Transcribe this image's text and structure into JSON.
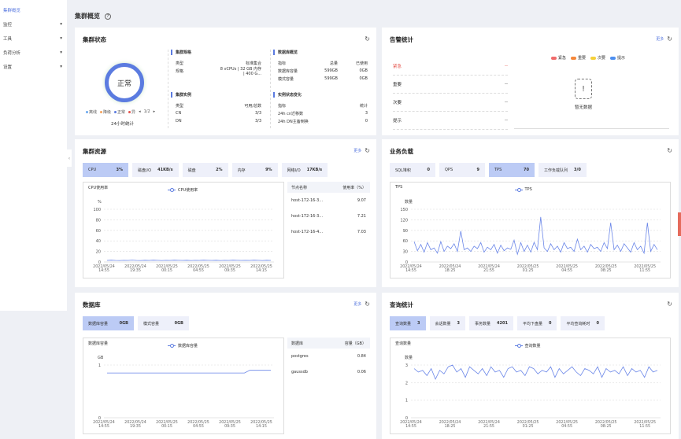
{
  "sidebar": {
    "items": [
      {
        "label": "集群概览",
        "active": true
      },
      {
        "label": "监控",
        "arrow": "▾"
      },
      {
        "label": "工具",
        "arrow": "▾"
      },
      {
        "label": "负荷分析",
        "arrow": "▾"
      },
      {
        "label": "设置",
        "arrow": "▾"
      }
    ],
    "collapse_icon": "‹"
  },
  "header": {
    "title": "集群概览",
    "help_icon": "?"
  },
  "status": {
    "title": "集群状态",
    "state": "正常",
    "legend": [
      {
        "label": "离线",
        "color": "#6aa8f0"
      },
      {
        "label": "降级",
        "color": "#f5a25d"
      },
      {
        "label": "正常",
        "color": "#5b7be0"
      },
      {
        "label": "异",
        "color": "#e5534b"
      }
    ],
    "page": "1/2",
    "stat_label": "24小时统计",
    "spec": {
      "title": "集群规格",
      "rows": [
        [
          "类型",
          "标准集合"
        ],
        [
          "规格",
          "8 vCPUs | 32 GB 内存 | 400 G..."
        ]
      ]
    },
    "instances": {
      "title": "集群实例",
      "rows": [
        [
          "类型",
          "可用/总数"
        ],
        [
          "CN",
          "3/3"
        ],
        [
          "DN",
          "3/3"
        ]
      ]
    },
    "db": {
      "title": "数据库概览",
      "rows": [
        [
          "指标",
          "总量",
          "已使用"
        ],
        [
          "数据库容量",
          "599GB",
          "0GB"
        ],
        [
          "模式容量",
          "599GB",
          "0GB"
        ]
      ]
    },
    "changes": {
      "title": "实例状态变化",
      "rows": [
        [
          "指标",
          "统计"
        ],
        [
          "24h cn迁移数",
          "3"
        ],
        [
          "24h DN主备倒换",
          "0"
        ]
      ]
    }
  },
  "alarm": {
    "title": "告警统计",
    "more": "更多",
    "rows": [
      {
        "label": "紧急",
        "value": "--",
        "color": "#e5534b"
      },
      {
        "label": "重要",
        "value": "--"
      },
      {
        "label": "次要",
        "value": "--"
      },
      {
        "label": "提示",
        "value": "--"
      }
    ],
    "legend": [
      {
        "label": "紧急",
        "color": "#f06b6b"
      },
      {
        "label": "重要",
        "color": "#f5883a"
      },
      {
        "label": "次要",
        "color": "#f5d03a"
      },
      {
        "label": "提示",
        "color": "#4d8ff0"
      }
    ],
    "empty": "暂无数据"
  },
  "resources": {
    "title": "集群资源",
    "more": "更多",
    "kpis": [
      {
        "label": "CPU",
        "value": "3%",
        "selected": true
      },
      {
        "label": "磁盘I/O",
        "value": "41KB/s"
      },
      {
        "label": "磁盘",
        "value": "2%"
      },
      {
        "label": "内存",
        "value": "9%"
      },
      {
        "label": "网络I/O",
        "value": "17KB/s"
      }
    ],
    "table": {
      "headers": [
        "节点名称",
        "使用率（%）"
      ],
      "rows": [
        [
          "host-172-16-3...",
          "9.07"
        ],
        [
          "host-172-16-3...",
          "7.21"
        ],
        [
          "host-172-16-4...",
          "7.03"
        ]
      ]
    }
  },
  "workload": {
    "title": "业务负载",
    "kpis": [
      {
        "label": "SQL堆积",
        "value": "0"
      },
      {
        "label": "QPS",
        "value": "9"
      },
      {
        "label": "TPS",
        "value": "70",
        "selected": true
      },
      {
        "label": "工作负载队列",
        "value": "3/0"
      }
    ]
  },
  "database": {
    "title": "数据库",
    "more": "更多",
    "kpis": [
      {
        "label": "数据库容量",
        "value": "0GB",
        "selected": true
      },
      {
        "label": "模式容量",
        "value": "0GB"
      }
    ],
    "table": {
      "headers": [
        "数据库",
        "容量（GB）"
      ],
      "rows": [
        [
          "postgres",
          "0.84"
        ],
        [
          "gaussdb",
          "0.06"
        ]
      ]
    }
  },
  "query": {
    "title": "查询统计",
    "kpis": [
      {
        "label": "查询数量",
        "value": "3",
        "selected": true
      },
      {
        "label": "会话数量",
        "value": "3"
      },
      {
        "label": "事务数量",
        "value": "4201"
      },
      {
        "label": "平均下盘量",
        "value": "0"
      },
      {
        "label": "平均查询耗时",
        "value": "0"
      }
    ]
  },
  "chart_data": [
    {
      "id": "cpu",
      "type": "line",
      "title": "CPU使用率",
      "legend": "CPU使用率",
      "ylabel": "%",
      "ylim": [
        0,
        100
      ],
      "yticks": [
        0,
        20,
        40,
        60,
        80,
        100
      ],
      "xticks": [
        "2022/05/24 14:55",
        "2022/05/24 19:35",
        "2022/05/25 00:15",
        "2022/05/25 04:55",
        "2022/05/25 09:35",
        "2022/05/25 14:15"
      ],
      "values": [
        3,
        3.5,
        3,
        2.8,
        3.2,
        3,
        3.6,
        3,
        2.9,
        3.3,
        3,
        3.4,
        3.1,
        2.8,
        3.2,
        3,
        3.5,
        3.1,
        3,
        3.3,
        2.9,
        3.2,
        3,
        3.4,
        3.1,
        3,
        3.3,
        2.9,
        3.2,
        3,
        3.5,
        3.1,
        3,
        3.2,
        3,
        3.4,
        3.1,
        2.9,
        3.3,
        3
      ]
    },
    {
      "id": "tps",
      "type": "line",
      "title": "TPS",
      "legend": "TPS",
      "ylabel": "数量",
      "ylim": [
        0,
        150
      ],
      "yticks": [
        0,
        30,
        60,
        90,
        120,
        150
      ],
      "xticks": [
        "2022/05/24 14:55",
        "2022/05/24 18:25",
        "2022/05/24 21:55",
        "2022/05/25 01:25",
        "2022/05/25 04:55",
        "2022/05/25 08:25",
        "2022/05/25 11:55"
      ],
      "values": [
        58,
        32,
        50,
        28,
        55,
        35,
        40,
        25,
        58,
        30,
        45,
        38,
        52,
        30,
        88,
        35,
        40,
        30,
        45,
        38,
        55,
        28,
        42,
        35,
        50,
        25,
        48,
        32,
        40,
        36,
        62,
        22,
        55,
        30,
        48,
        28,
        56,
        35,
        128,
        40,
        30,
        52,
        35,
        45,
        28,
        55,
        38,
        42,
        30,
        65,
        35,
        45,
        28,
        50,
        38,
        42,
        30,
        55,
        38,
        112,
        35,
        48,
        30,
        52,
        40,
        28,
        55,
        35,
        45,
        25,
        112,
        30,
        50,
        35
      ]
    },
    {
      "id": "dbsize",
      "type": "line",
      "title": "数据库容量",
      "legend": "数据库容量",
      "ylabel": "GB",
      "ylim": [
        0,
        1
      ],
      "yticks": [
        0,
        1
      ],
      "xticks": [
        "2022/05/24 14:55",
        "2022/05/24 19:35",
        "2022/05/25 00:15",
        "2022/05/25 04:55",
        "2022/05/25 09:35",
        "2022/05/25 14:15"
      ],
      "values": [
        0.85,
        0.85,
        0.85,
        0.85,
        0.85,
        0.85,
        0.85,
        0.85,
        0.85,
        0.85,
        0.85,
        0.85,
        0.85,
        0.85,
        0.85,
        0.85,
        0.85,
        0.85,
        0.85,
        0.85,
        0.85,
        0.85,
        0.85,
        0.85,
        0.85,
        0.85,
        0.85,
        0.9,
        0.9,
        0.9,
        0.9,
        0.9
      ]
    },
    {
      "id": "queries",
      "type": "line",
      "title": "查询数量",
      "legend": "查询数量",
      "ylabel": "数量",
      "ylim": [
        0,
        3
      ],
      "yticks": [
        0,
        1,
        2,
        3
      ],
      "xticks": [
        "2022/05/24 14:55",
        "2022/05/24 18:25",
        "2022/05/24 21:55",
        "2022/05/25 01:25",
        "2022/05/25 04:55",
        "2022/05/25 08:25",
        "2022/05/25 11:55"
      ],
      "values": [
        2.8,
        2.6,
        2.7,
        2.4,
        2.8,
        2.2,
        2.7,
        2.5,
        2.9,
        3,
        2.6,
        2.8,
        2.3,
        2.9,
        2.7,
        2.5,
        2.8,
        2.4,
        2.9,
        2.6,
        2.7,
        2.3,
        2.8,
        2.9,
        2.6,
        2.7,
        2.4,
        2.9,
        2.8,
        2.5,
        2.7,
        2.6,
        2.9,
        2.3,
        2.8,
        2.5,
        2.7,
        2.9,
        2.6,
        2.4,
        2.8,
        2.7,
        2.5,
        2.9,
        2.3,
        2.8,
        2.6,
        2.7,
        2.5,
        2.9,
        2.4,
        2.8,
        2.6,
        2.7,
        2.3,
        2.9,
        2.6,
        2.7
      ]
    }
  ]
}
